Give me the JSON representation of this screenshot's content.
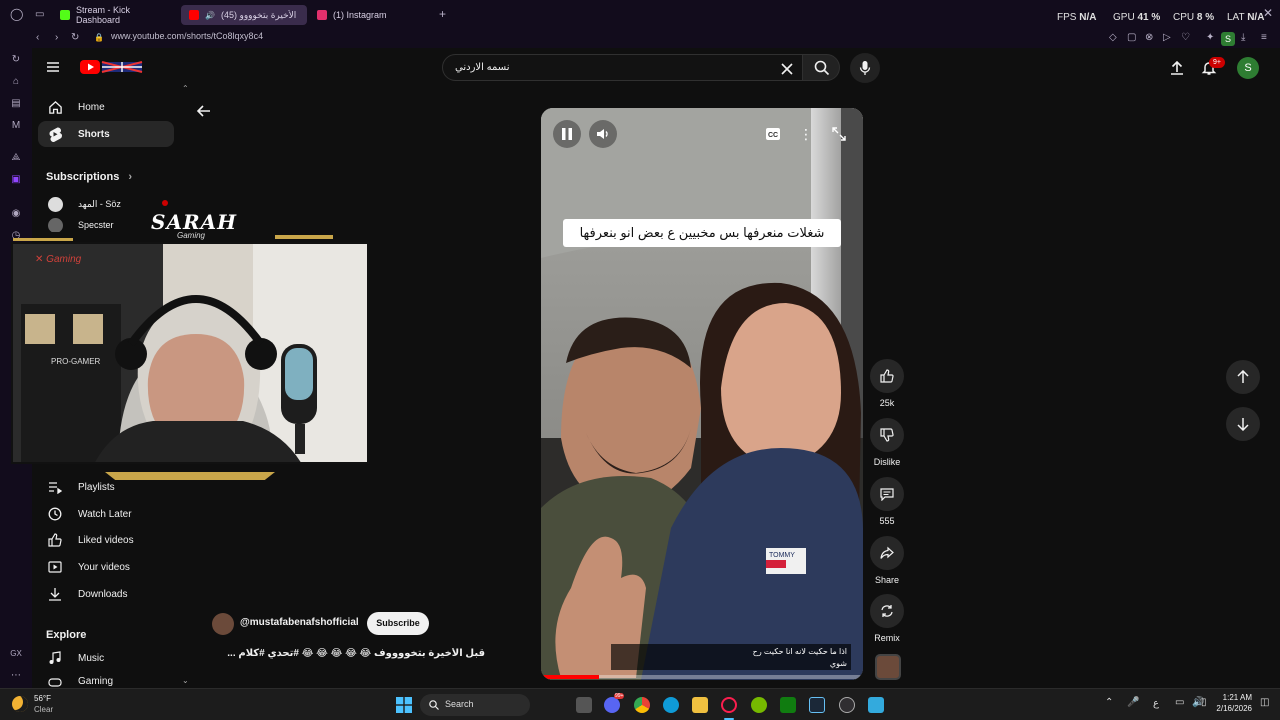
{
  "browser": {
    "tabs": [
      {
        "label": "Stream - Kick Dashboard",
        "color": "#53fc18"
      },
      {
        "label": "(45) قبل الأخيرة بتخوووو",
        "color": "#ff0000"
      },
      {
        "label": "(1) Instagram",
        "color": "#e1306c"
      }
    ],
    "url": "www.youtube.com/shorts/tCo8lqxy8c4",
    "perf": {
      "fps_label": "FPS",
      "fps_value": "N/A",
      "gpu_label": "GPU",
      "gpu_value": "41 %",
      "cpu_label": "CPU",
      "cpu_value": "8 %",
      "lat_label": "LAT",
      "lat_value": "N/A"
    },
    "profile_initial": "S"
  },
  "youtube": {
    "search_value": "نسمه الاردني",
    "notifications_badge": "9+",
    "avatar_initial": "S",
    "nav": {
      "home": "Home",
      "shorts": "Shorts",
      "subscriptions": "Subscriptions",
      "sub_item_1": "المهد - Söz",
      "sub_item_2": "Specster",
      "playlists": "Playlists",
      "watch_later": "Watch Later",
      "liked_videos": "Liked videos",
      "your_videos": "Your videos",
      "downloads": "Downloads",
      "explore": "Explore",
      "music": "Music",
      "gaming": "Gaming"
    },
    "short": {
      "caption_overlay": "شغلات منعرفها بس مخبيين ع بعض انو بنعرفها",
      "subtitle": "اذا ما حكيت لانه انا حكيت رح شوي",
      "channel": "@mustafabenafshofficial",
      "subscribe": "Subscribe",
      "title": "قبل الأخيرة بتخووووف 😂 😂 😂 😂 😂 #تحدي #كلام ...",
      "tommy_text": "TOMMY",
      "progress_fraction": 0.18
    },
    "actions": {
      "likes": "25k",
      "dislike": "Dislike",
      "comments": "555",
      "share": "Share",
      "remix": "Remix"
    }
  },
  "webcam": {
    "logo_name": "SARAH",
    "logo_sub": "Gaming",
    "chair_brand": "PRO-GAMER",
    "x_gaming": "Gaming"
  },
  "taskbar": {
    "weather_temp": "56°F",
    "weather_desc": "Clear",
    "search": "Search",
    "lang": "ع",
    "time": "1:21 AM",
    "date": "2/16/2026",
    "badge": "99+"
  }
}
